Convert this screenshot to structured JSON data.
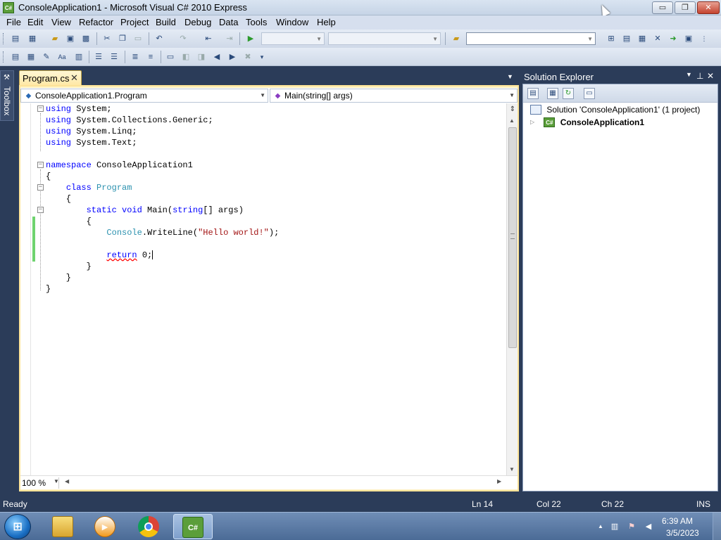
{
  "window": {
    "title": "ConsoleApplication1 - Microsoft Visual C# 2010 Express",
    "app_icon": "C#",
    "min_icon": "▭",
    "max_icon": "❐",
    "close_icon": "✕"
  },
  "menu": [
    "File",
    "Edit",
    "View",
    "Refactor",
    "Project",
    "Build",
    "Debug",
    "Data",
    "Tools",
    "Window",
    "Help"
  ],
  "toolbox": {
    "label": "Toolbox"
  },
  "document_tab": {
    "label": "Program.cs",
    "close": "✕"
  },
  "navbar": {
    "type_combo": "ConsoleApplication1.Program",
    "member_combo": "Main(string[] args)"
  },
  "code_lines": [
    [
      {
        "t": "using",
        "c": "kw"
      },
      {
        "t": " System;"
      }
    ],
    [
      {
        "t": "using",
        "c": "kw"
      },
      {
        "t": " System.Collections.Generic;"
      }
    ],
    [
      {
        "t": "using",
        "c": "kw"
      },
      {
        "t": " System.Linq;"
      }
    ],
    [
      {
        "t": "using",
        "c": "kw"
      },
      {
        "t": " System.Text;"
      }
    ],
    [],
    [
      {
        "t": "namespace",
        "c": "kw"
      },
      {
        "t": " ConsoleApplication1"
      }
    ],
    [
      {
        "t": "{"
      }
    ],
    [
      {
        "t": "    "
      },
      {
        "t": "class",
        "c": "kw"
      },
      {
        "t": " "
      },
      {
        "t": "Program",
        "c": "ty"
      }
    ],
    [
      {
        "t": "    {"
      }
    ],
    [
      {
        "t": "        "
      },
      {
        "t": "static",
        "c": "kw"
      },
      {
        "t": " "
      },
      {
        "t": "void",
        "c": "kw"
      },
      {
        "t": " Main("
      },
      {
        "t": "string",
        "c": "kw"
      },
      {
        "t": "[] args)"
      }
    ],
    [
      {
        "t": "        {"
      }
    ],
    [
      {
        "t": "            "
      },
      {
        "t": "Console",
        "c": "ty"
      },
      {
        "t": ".WriteLine("
      },
      {
        "t": "\"Hello world!\"",
        "c": "st"
      },
      {
        "t": ");"
      }
    ],
    [],
    [
      {
        "t": "            "
      },
      {
        "t": "return",
        "c": "kw squig"
      },
      {
        "t": " 0;"
      },
      {
        "caret": true
      }
    ],
    [
      {
        "t": "        }"
      }
    ],
    [
      {
        "t": "    }"
      }
    ],
    [
      {
        "t": "}"
      }
    ]
  ],
  "editor_bottom": {
    "zoom": "100 %"
  },
  "solution_explorer": {
    "title": "Solution Explorer",
    "solution_label": "Solution 'ConsoleApplication1' (1 project)",
    "project_label": "ConsoleApplication1"
  },
  "status": {
    "text": "Ready",
    "ln": "Ln 14",
    "col": "Col 22",
    "ch": "Ch 22",
    "mode": "INS"
  },
  "taskbar": {
    "time": "6:39 AM",
    "date": "3/5/2023",
    "vcs_icon": "C#"
  },
  "colors": {
    "keyword": "#0000ff",
    "type": "#2b91af",
    "string": "#a31515",
    "chrome_dark": "#2b3c59",
    "changed_line": "#6fd36f"
  }
}
